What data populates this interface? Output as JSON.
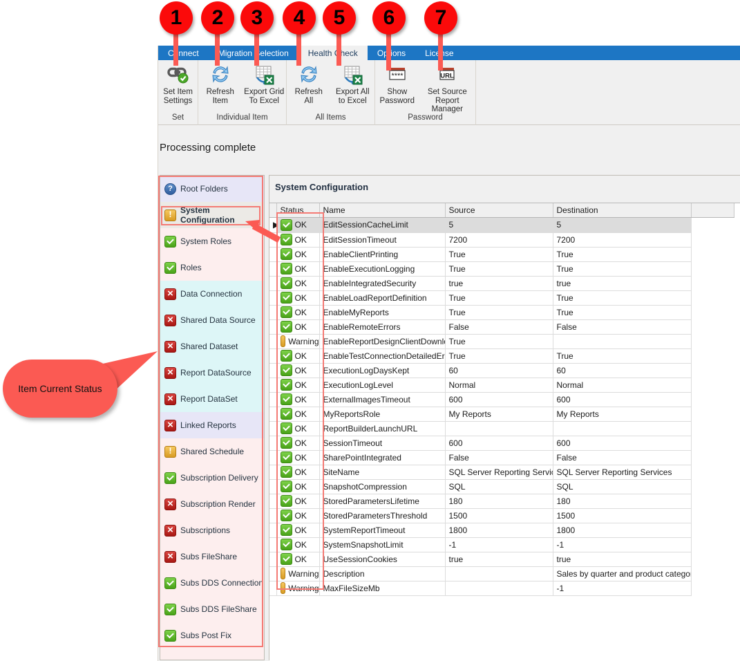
{
  "window": {
    "status_text": "Processing complete"
  },
  "tabs": [
    {
      "label": "Connect",
      "active": false
    },
    {
      "label": "Migration Selection",
      "active": false
    },
    {
      "label": "Health Check",
      "active": true
    },
    {
      "label": "Options",
      "active": false
    },
    {
      "label": "License",
      "active": false
    }
  ],
  "ribbon": {
    "groups": [
      {
        "title": "Set",
        "buttons": [
          {
            "label": "Set Item\nSettings",
            "icon": "link-check-icon"
          }
        ]
      },
      {
        "title": "Individual Item",
        "buttons": [
          {
            "label": "Refresh\nItem",
            "icon": "refresh-icon"
          },
          {
            "label": "Export Grid\nTo Excel",
            "icon": "export-excel-icon"
          }
        ]
      },
      {
        "title": "All Items",
        "buttons": [
          {
            "label": "Refresh\nAll",
            "icon": "refresh-icon"
          },
          {
            "label": "Export All\nto Excel",
            "icon": "export-excel-icon"
          }
        ]
      },
      {
        "title": "Password",
        "buttons": [
          {
            "label": "Show\nPassword",
            "icon": "password-asterisks-icon"
          },
          {
            "label": "Set Source\nReport Manager",
            "icon": "url-icon"
          }
        ]
      }
    ]
  },
  "tree": {
    "items": [
      {
        "label": "Root Folders",
        "status": "help",
        "band": "lavender"
      },
      {
        "label": "System Configuration",
        "status": "warning",
        "band": "gray",
        "selected": true
      },
      {
        "label": "System Roles",
        "status": "ok",
        "band": "pink"
      },
      {
        "label": "Roles",
        "status": "ok",
        "band": "pink"
      },
      {
        "label": "Data Connection",
        "status": "error",
        "band": "cyan"
      },
      {
        "label": "Shared Data Source",
        "status": "error",
        "band": "cyan"
      },
      {
        "label": "Shared Dataset",
        "status": "error",
        "band": "cyan"
      },
      {
        "label": "Report DataSource",
        "status": "error",
        "band": "cyan"
      },
      {
        "label": "Report DataSet",
        "status": "error",
        "band": "cyan"
      },
      {
        "label": "Linked Reports",
        "status": "error",
        "band": "lavender"
      },
      {
        "label": "Shared Schedule",
        "status": "warning",
        "band": "pink"
      },
      {
        "label": "Subscription Delivery",
        "status": "ok",
        "band": "pink"
      },
      {
        "label": "Subscription Render",
        "status": "error",
        "band": "pink"
      },
      {
        "label": "Subscriptions",
        "status": "error",
        "band": "pink"
      },
      {
        "label": "Subs FileShare",
        "status": "error",
        "band": "pink"
      },
      {
        "label": "Subs DDS Connection",
        "status": "ok",
        "band": "pink"
      },
      {
        "label": "Subs DDS FileShare",
        "status": "ok",
        "band": "pink"
      },
      {
        "label": "Subs Post Fix",
        "status": "ok",
        "band": "pink"
      }
    ]
  },
  "grid": {
    "title": "System Configuration",
    "columns": [
      "Status",
      "Name",
      "Source",
      "Destination"
    ],
    "rows": [
      {
        "status": "OK",
        "kind": "ok",
        "name": "EditSessionCacheLimit",
        "source": "5",
        "destination": "5"
      },
      {
        "status": "OK",
        "kind": "ok",
        "name": "EditSessionTimeout",
        "source": "7200",
        "destination": "7200"
      },
      {
        "status": "OK",
        "kind": "ok",
        "name": "EnableClientPrinting",
        "source": "True",
        "destination": "True"
      },
      {
        "status": "OK",
        "kind": "ok",
        "name": "EnableExecutionLogging",
        "source": "True",
        "destination": "True"
      },
      {
        "status": "OK",
        "kind": "ok",
        "name": "EnableIntegratedSecurity",
        "source": "true",
        "destination": "true"
      },
      {
        "status": "OK",
        "kind": "ok",
        "name": "EnableLoadReportDefinition",
        "source": "True",
        "destination": "True"
      },
      {
        "status": "OK",
        "kind": "ok",
        "name": "EnableMyReports",
        "source": "True",
        "destination": "True"
      },
      {
        "status": "OK",
        "kind": "ok",
        "name": "EnableRemoteErrors",
        "source": "False",
        "destination": "False"
      },
      {
        "status": "Warning",
        "kind": "warning",
        "name": "EnableReportDesignClientDownload",
        "source": "True",
        "destination": ""
      },
      {
        "status": "OK",
        "kind": "ok",
        "name": "EnableTestConnectionDetailedErrors",
        "source": "True",
        "destination": "True"
      },
      {
        "status": "OK",
        "kind": "ok",
        "name": "ExecutionLogDaysKept",
        "source": "60",
        "destination": "60"
      },
      {
        "status": "OK",
        "kind": "ok",
        "name": "ExecutionLogLevel",
        "source": "Normal",
        "destination": "Normal"
      },
      {
        "status": "OK",
        "kind": "ok",
        "name": "ExternalImagesTimeout",
        "source": "600",
        "destination": "600"
      },
      {
        "status": "OK",
        "kind": "ok",
        "name": "MyReportsRole",
        "source": "My Reports",
        "destination": "My Reports"
      },
      {
        "status": "OK",
        "kind": "ok",
        "name": "ReportBuilderLaunchURL",
        "source": "",
        "destination": ""
      },
      {
        "status": "OK",
        "kind": "ok",
        "name": "SessionTimeout",
        "source": "600",
        "destination": "600"
      },
      {
        "status": "OK",
        "kind": "ok",
        "name": "SharePointIntegrated",
        "source": "False",
        "destination": "False"
      },
      {
        "status": "OK",
        "kind": "ok",
        "name": "SiteName",
        "source": "SQL Server Reporting Services",
        "destination": "SQL Server Reporting Services"
      },
      {
        "status": "OK",
        "kind": "ok",
        "name": "SnapshotCompression",
        "source": "SQL",
        "destination": "SQL"
      },
      {
        "status": "OK",
        "kind": "ok",
        "name": "StoredParametersLifetime",
        "source": "180",
        "destination": "180"
      },
      {
        "status": "OK",
        "kind": "ok",
        "name": "StoredParametersThreshold",
        "source": "1500",
        "destination": "1500"
      },
      {
        "status": "OK",
        "kind": "ok",
        "name": "SystemReportTimeout",
        "source": "1800",
        "destination": "1800"
      },
      {
        "status": "OK",
        "kind": "ok",
        "name": "SystemSnapshotLimit",
        "source": "-1",
        "destination": "-1"
      },
      {
        "status": "OK",
        "kind": "ok",
        "name": "UseSessionCookies",
        "source": "true",
        "destination": "true"
      },
      {
        "status": "Warning",
        "kind": "warning",
        "name": "Description",
        "source": "",
        "destination": "Sales by quarter and product category."
      },
      {
        "status": "Warning",
        "kind": "warning",
        "name": "MaxFileSizeMb",
        "source": "",
        "destination": "-1"
      }
    ]
  },
  "annotations": {
    "badges": [
      "1",
      "2",
      "3",
      "4",
      "5",
      "6",
      "7"
    ],
    "callout_text": "Item Current Status",
    "accent_red": "#fb0a0a",
    "callout_red": "#fb5a53"
  }
}
